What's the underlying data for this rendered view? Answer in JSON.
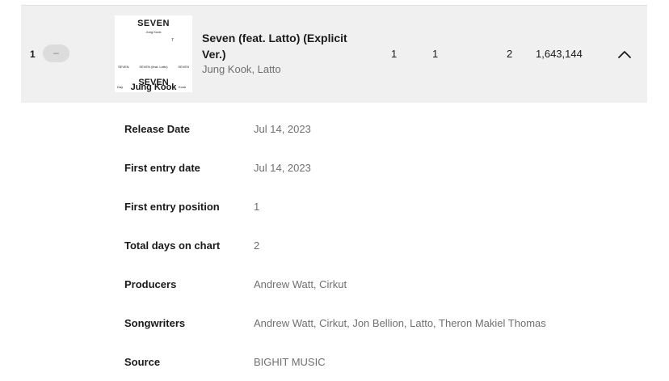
{
  "track_row": {
    "rank": "1",
    "change": "–",
    "cover": {
      "title_top": "SEVEN",
      "subtitle_top": "Jung Kook",
      "mark": "7",
      "middle_left": "SEVEN",
      "middle_center": "SEVEN (feat. Latto)",
      "middle_right": "SEVEN",
      "title_bottom": "SEVEN",
      "artist_bottom": "Jung Kook",
      "bottom_left": "Day",
      "bottom_right": "Kook"
    },
    "title": "Seven (feat. Latto) (Explicit Ver.)",
    "artists": [
      "Jung Kook",
      "Latto"
    ],
    "artist_separator": ", ",
    "peak": "1",
    "prev": "1",
    "streak": "2",
    "streams": "1,643,144",
    "toggle_icon": "chevron-up-icon"
  },
  "details": [
    {
      "label": "Release Date",
      "value": "Jul 14, 2023"
    },
    {
      "label": "First entry date",
      "value": "Jul 14, 2023"
    },
    {
      "label": "First entry position",
      "value": "1"
    },
    {
      "label": "Total days on chart",
      "value": "2"
    },
    {
      "label": "Producers",
      "value": "Andrew Watt, Cirkut"
    },
    {
      "label": "Songwriters",
      "value": "Andrew Watt, Cirkut, Jon Bellion, Latto, Theron Makiel Thomas"
    },
    {
      "label": "Source",
      "value": "BIGHIT MUSIC"
    }
  ]
}
